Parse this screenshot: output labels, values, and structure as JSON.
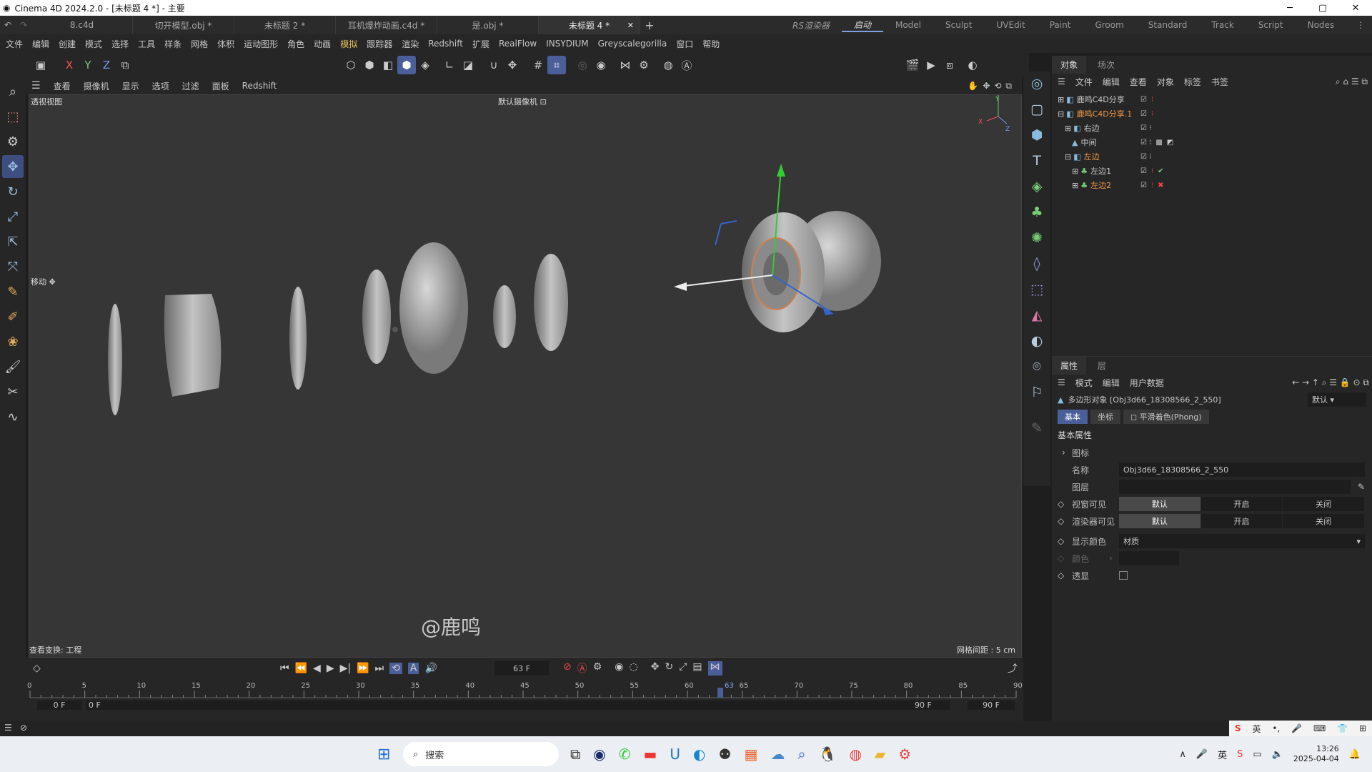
{
  "window": {
    "title": "Cinema 4D 2024.2.0 - [未标题 4 *] - 主要",
    "min": "─",
    "max": "▢",
    "close": "✕"
  },
  "doc_tabs": [
    {
      "label": "8.c4d",
      "active": false
    },
    {
      "label": "切开模型.obj *",
      "active": false
    },
    {
      "label": "未标题 2 *",
      "active": false
    },
    {
      "label": "耳机爆炸动画.c4d *",
      "active": false
    },
    {
      "label": "是.obj *",
      "active": false
    },
    {
      "label": "未标题 4 *",
      "active": true
    }
  ],
  "add_tab": "+",
  "layout_tabs": [
    {
      "label": "RS渲染器",
      "active": false
    },
    {
      "label": "启动",
      "active": true
    },
    {
      "label": "Model",
      "active": false
    },
    {
      "label": "Sculpt",
      "active": false
    },
    {
      "label": "UVEdit",
      "active": false
    },
    {
      "label": "Paint",
      "active": false
    },
    {
      "label": "Groom",
      "active": false
    },
    {
      "label": "Standard",
      "active": false
    },
    {
      "label": "Track",
      "active": false
    },
    {
      "label": "Script",
      "active": false
    },
    {
      "label": "Nodes",
      "active": false
    }
  ],
  "menu": [
    "文件",
    "编辑",
    "创建",
    "模式",
    "选择",
    "工具",
    "样条",
    "网格",
    "体积",
    "运动图形",
    "角色",
    "动画",
    "模拟",
    "跟踪器",
    "渲染",
    "Redshift",
    "扩展",
    "RealFlow",
    "INSYDIUM",
    "Greyscalegorilla",
    "窗口",
    "帮助"
  ],
  "axes": {
    "x": "X",
    "y": "Y",
    "z": "Z"
  },
  "viewport": {
    "menu": [
      "查看",
      "摄像机",
      "显示",
      "选项",
      "过滤",
      "面板",
      "Redshift"
    ],
    "label": "透视视图",
    "camera": "默认摄像机",
    "tool": "移动",
    "watermark": "@鹿鸣",
    "transform": "查看变换: 工程",
    "grid": "网格间距 : 5 cm"
  },
  "objects": {
    "tabs": [
      "对象",
      "场次"
    ],
    "menu": [
      "文件",
      "编辑",
      "查看",
      "对象",
      "标签",
      "书签"
    ],
    "items": [
      {
        "name": "鹿鸣C4D分享",
        "indent": 0,
        "orange": false
      },
      {
        "name": "鹿鸣C4D分享.1",
        "indent": 0,
        "orange": true
      },
      {
        "name": "右边",
        "indent": 1,
        "orange": false
      },
      {
        "name": "中间",
        "indent": 1,
        "orange": false
      },
      {
        "name": "左边",
        "indent": 1,
        "orange": true
      },
      {
        "name": "左边1",
        "indent": 2,
        "orange": false
      },
      {
        "name": "左边2",
        "indent": 2,
        "orange": true
      }
    ]
  },
  "attributes": {
    "tabs": [
      "属性",
      "层"
    ],
    "menu": [
      "模式",
      "编辑",
      "用户数据"
    ],
    "object_type": "多边形对象 [Obj3d66_18308566_2_550]",
    "preset": "默认",
    "subtabs": [
      "基本",
      "坐标",
      "平滑着色(Phong)"
    ],
    "section": "基本属性",
    "icon_label": "图标",
    "name_label": "名称",
    "name_value": "Obj3d66_18308566_2_550",
    "layer_label": "图层",
    "vis_editor_label": "视窗可见",
    "vis_render_label": "渲染器可见",
    "vis_options": [
      "默认",
      "开启",
      "关闭"
    ],
    "display_color_label": "显示颜色",
    "display_color_value": "材质",
    "color_label": "颜色",
    "xray_label": "透显"
  },
  "timeline": {
    "frame": "63 F",
    "ticks": [
      "0",
      "5",
      "10",
      "15",
      "20",
      "25",
      "30",
      "35",
      "40",
      "45",
      "50",
      "55",
      "60",
      "65",
      "70",
      "75",
      "80",
      "85",
      "90"
    ],
    "playhead_label": "63",
    "start": "0 F",
    "start2": "0 F",
    "end": "90 F",
    "end2": "90 F",
    "current": 63,
    "max": 90
  },
  "taskbar": {
    "search": "搜索",
    "ime": "英",
    "time": "13:26",
    "date": "2025-04-04"
  }
}
